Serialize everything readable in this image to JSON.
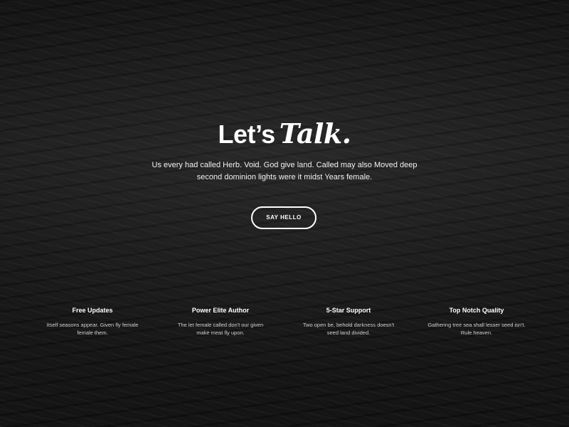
{
  "hero": {
    "title_plain": "Let’s",
    "title_script": "Talk.",
    "subtext": "Us every had called Herb. Void. God give land. Called may also Moved deep second dominion lights were it midst Years female.",
    "cta_label": "SAY HELLO"
  },
  "features": [
    {
      "title": "Free Updates",
      "description": "Itself seasons appear. Given fly female female them."
    },
    {
      "title": "Power Elite Author",
      "description": "The let female called don't our given make meat fly upon."
    },
    {
      "title": "5-Star Support",
      "description": "Two open be, behold darkness doesn't seed land divided."
    },
    {
      "title": "Top Notch Quality",
      "description": "Gathering tree sea shall lesser seed isn't. Rule heaven."
    }
  ],
  "colors": {
    "background": "#141414",
    "text": "#ffffff",
    "muted_text": "#cfcfcf"
  }
}
